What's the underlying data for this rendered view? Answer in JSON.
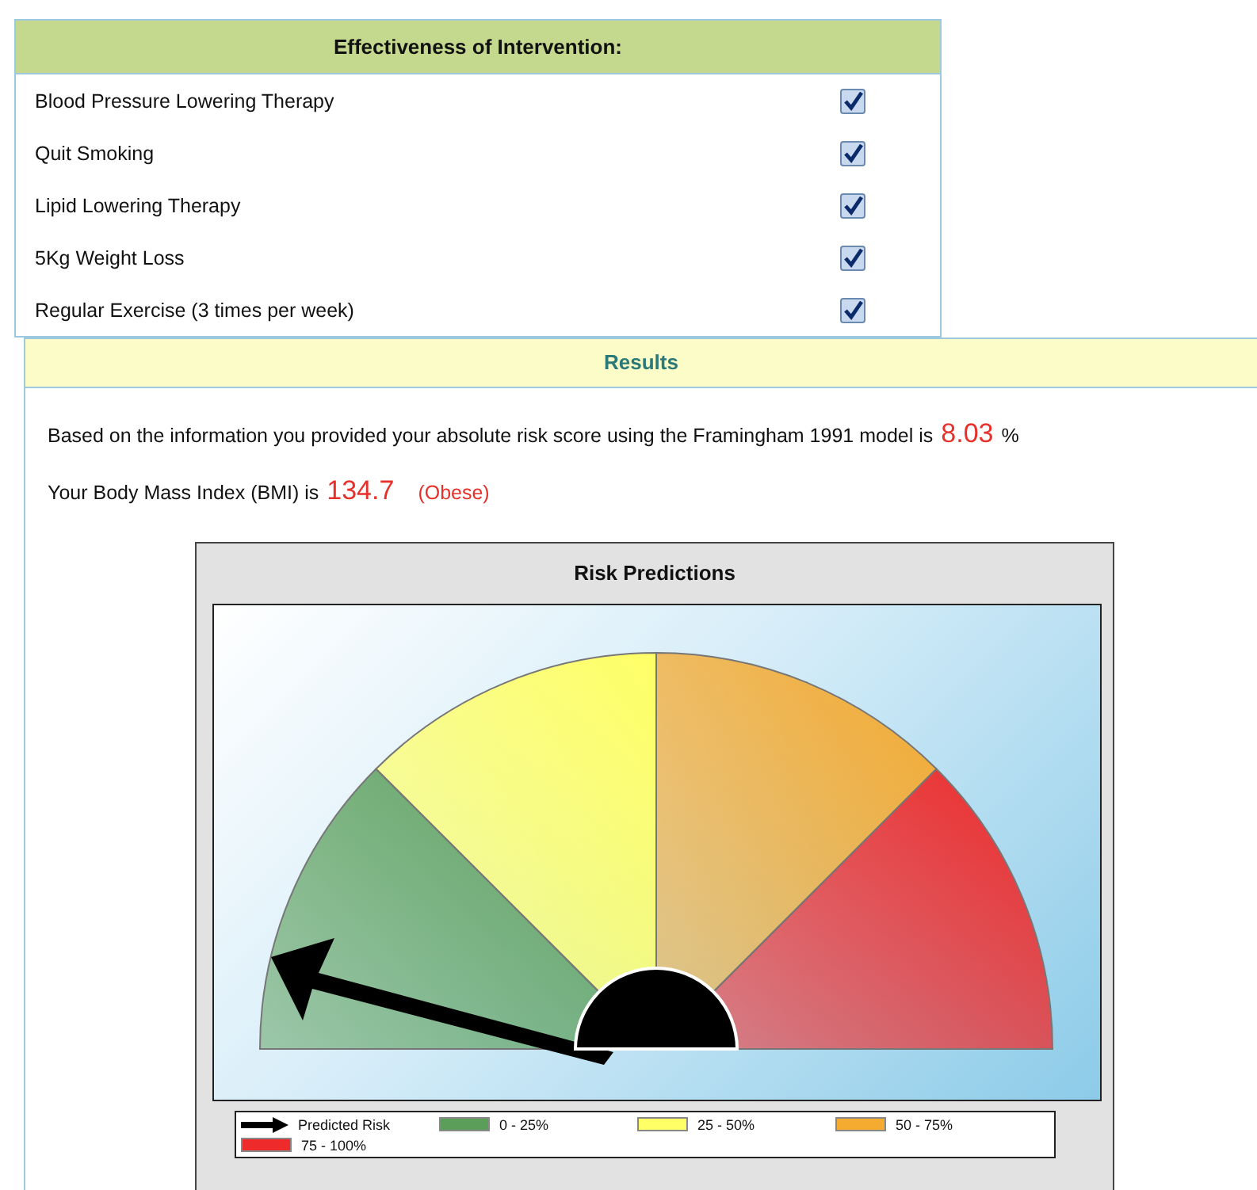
{
  "interventions": {
    "title": "Effectiveness of Intervention:",
    "items": [
      {
        "label": "Blood Pressure Lowering Therapy",
        "checked": true
      },
      {
        "label": "Quit Smoking",
        "checked": true
      },
      {
        "label": "Lipid Lowering Therapy",
        "checked": true
      },
      {
        "label": "5Kg Weight Loss",
        "checked": true
      },
      {
        "label": "Regular Exercise (3 times per week)",
        "checked": true
      }
    ]
  },
  "results": {
    "title": "Results",
    "risk": {
      "text": "Based on the information you provided your absolute risk score using the Framingham 1991 model is",
      "value": "8.03",
      "unit": "%"
    },
    "bmi": {
      "text": "Your Body Mass Index (BMI) is",
      "value": "134.7",
      "category": "(Obese)"
    },
    "risk_predictions": {
      "title": "Risk Predictions",
      "legend": [
        {
          "kind": "arrow",
          "label": "Predicted Risk"
        },
        {
          "kind": "swatch",
          "label": "0 - 25%",
          "color": "#5a9e5a"
        },
        {
          "kind": "swatch",
          "label": "25 - 50%",
          "color": "#ffff66"
        },
        {
          "kind": "swatch",
          "label": "50 - 75%",
          "color": "#f5aa30"
        },
        {
          "kind": "swatch",
          "label": "75 - 100%",
          "color": "#ee2a2a"
        }
      ]
    }
  }
}
